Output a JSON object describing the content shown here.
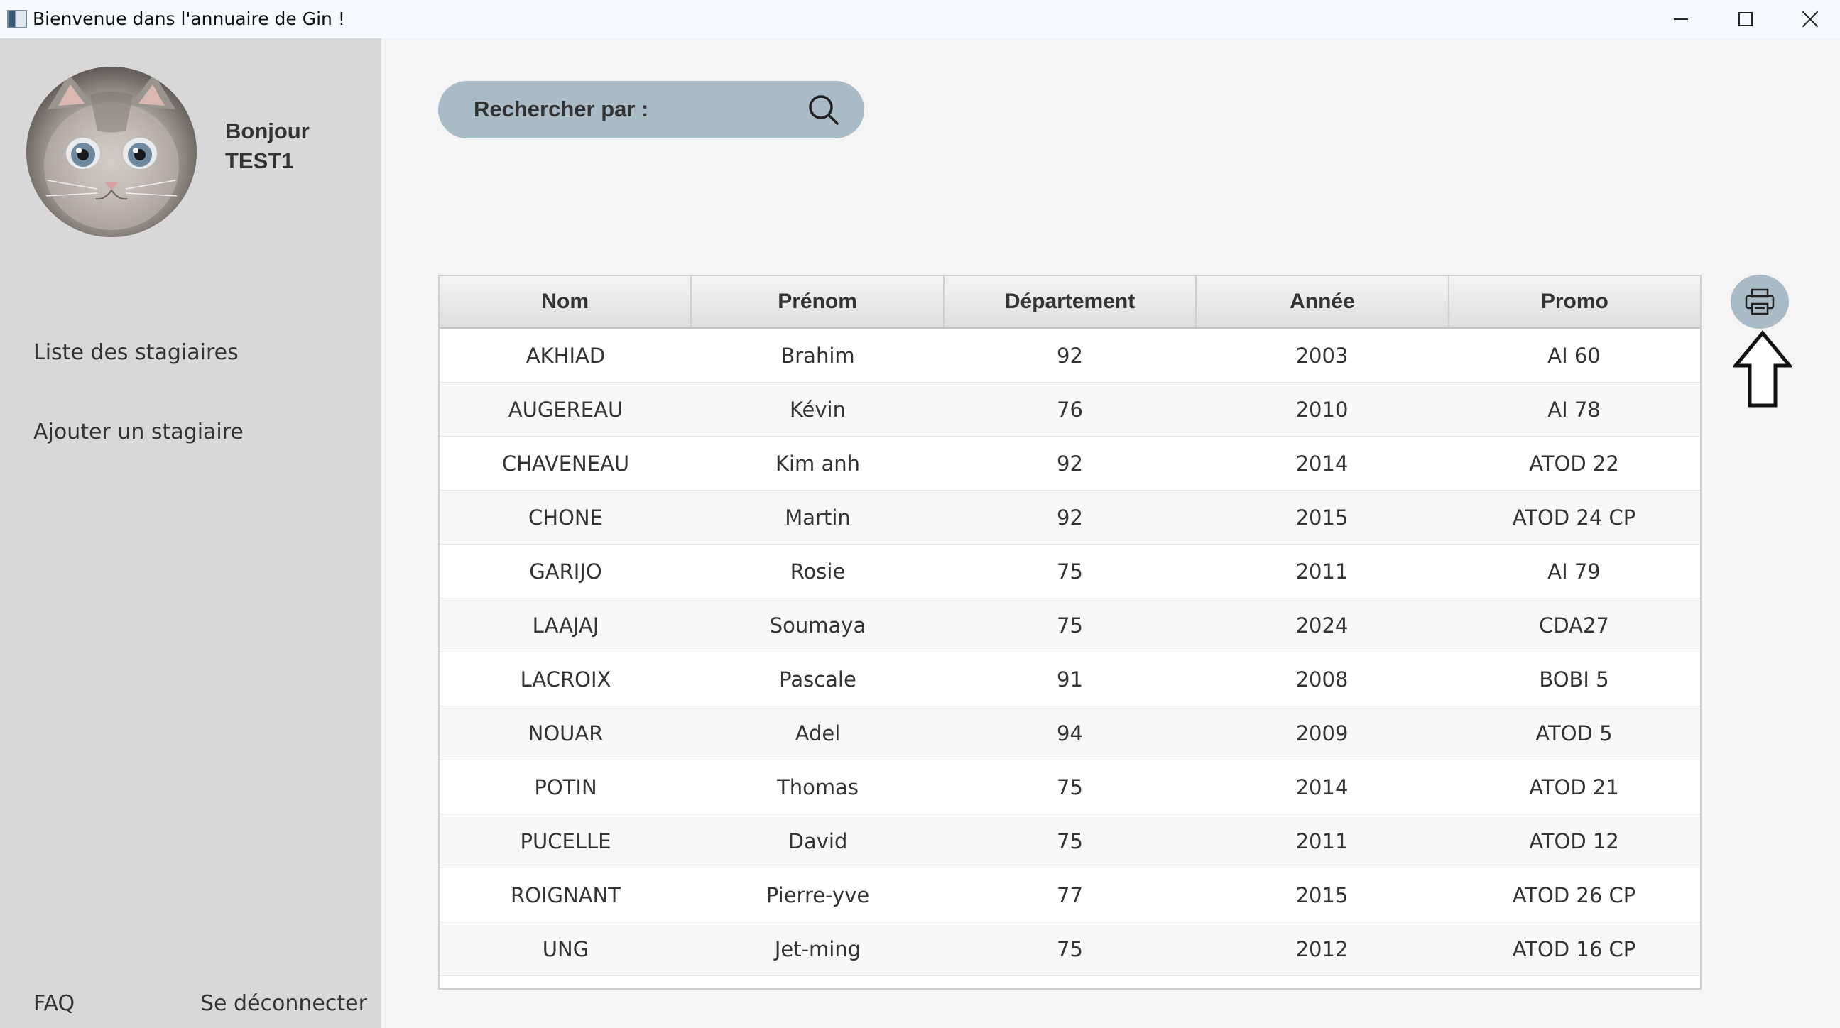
{
  "window": {
    "title": "Bienvenue dans l'annuaire de Gin !"
  },
  "user": {
    "greeting": "Bonjour",
    "name": "TEST1"
  },
  "sidebar": {
    "nav": [
      {
        "label": "Liste des stagiaires"
      },
      {
        "label": "Ajouter un stagiaire"
      }
    ],
    "faq": "FAQ",
    "logout": "Se déconnecter"
  },
  "search": {
    "label": "Rechercher par :"
  },
  "table": {
    "headers": [
      "Nom",
      "Prénom",
      "Département",
      "Année",
      "Promo"
    ],
    "rows": [
      [
        "AKHIAD",
        "Brahim",
        "92",
        "2003",
        "AI 60"
      ],
      [
        "AUGEREAU",
        "Kévin",
        "76",
        "2010",
        "AI 78"
      ],
      [
        "CHAVENEAU",
        "Kim anh",
        "92",
        "2014",
        "ATOD 22"
      ],
      [
        "CHONE",
        "Martin",
        "92",
        "2015",
        "ATOD 24 CP"
      ],
      [
        "GARIJO",
        "Rosie",
        "75",
        "2011",
        "AI 79"
      ],
      [
        "LAAJAJ",
        "Soumaya",
        "75",
        "2024",
        "CDA27"
      ],
      [
        "LACROIX",
        "Pascale",
        "91",
        "2008",
        "BOBI 5"
      ],
      [
        "NOUAR",
        "Adel",
        "94",
        "2009",
        "ATOD 5"
      ],
      [
        "POTIN",
        "Thomas",
        "75",
        "2014",
        "ATOD 21"
      ],
      [
        "PUCELLE",
        "David",
        "75",
        "2011",
        "ATOD 12"
      ],
      [
        "ROIGNANT",
        "Pierre-yve",
        "77",
        "2015",
        "ATOD 26 CP"
      ],
      [
        "UNG",
        "Jet-ming",
        "75",
        "2012",
        "ATOD 16 CP"
      ]
    ]
  },
  "icons": {
    "search": "search-icon",
    "print": "printer-icon",
    "arrow": "up-arrow-icon"
  },
  "colors": {
    "sidebar": "#d8d8d8",
    "accent": "#a9bbc6",
    "background": "#f4f4f4"
  }
}
